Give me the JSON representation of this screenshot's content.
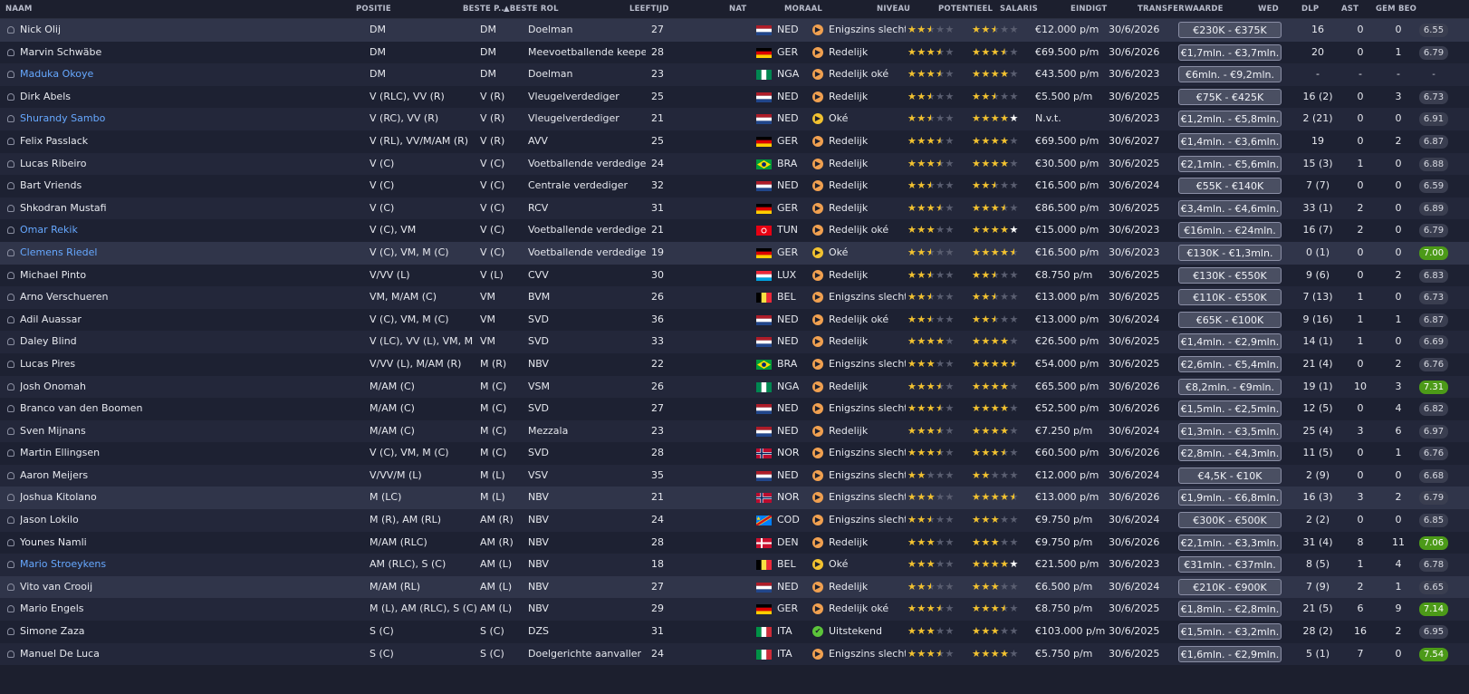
{
  "headers": {
    "naam": "NAAM",
    "positie": "POSITIE",
    "beste_positie": "BESTE P...",
    "beste_rol": "▲BESTE ROL",
    "leeftijd": "LEEFTIJD",
    "nat": "NAT",
    "moraal": "MORAAL",
    "niveau": "NIVEAU",
    "potentieel": "POTENTIEEL",
    "salaris": "SALARIS",
    "eindigt": "EINDIGT",
    "transferwaarde": "TRANSFERWAARDE",
    "wed": "WED",
    "dlp": "DLP",
    "ast": "AST",
    "gem_beo": "GEM BEO"
  },
  "colors": {
    "link": "#66a8ff",
    "moral_orange": "#f0a050",
    "moral_yellow": "#f2c230",
    "moral_green": "#5cc43a",
    "star": "#f2c230",
    "rating_good": "#4c9a18"
  },
  "players": [
    {
      "name": "Nick Olij",
      "link": false,
      "sel": true,
      "positie": "DM",
      "beste_positie": "DM",
      "beste_rol": "Doelman",
      "leeftijd": "27",
      "nat": "NED",
      "flag": "nl",
      "moraal": "Enigszins slecht",
      "moraal_level": "orange",
      "niveau": 2.5,
      "potentieel": 2.5,
      "potentieel_full": false,
      "salaris": "€12.000 p/m",
      "eindigt": "30/6/2026",
      "transferwaarde": "€230K - €375K",
      "wed": "16",
      "dlp": "0",
      "ast": "0",
      "gem_beo": "6.55",
      "gem_good": false
    },
    {
      "name": "Marvin Schwäbe",
      "link": false,
      "sel": false,
      "positie": "DM",
      "beste_positie": "DM",
      "beste_rol": "Meevoetballende keeper",
      "leeftijd": "28",
      "nat": "GER",
      "flag": "de",
      "moraal": "Redelijk",
      "moraal_level": "orange",
      "niveau": 3.5,
      "potentieel": 3.5,
      "potentieel_full": false,
      "salaris": "€69.500 p/m",
      "eindigt": "30/6/2026",
      "transferwaarde": "€1,7mln. - €3,7mln.",
      "wed": "20",
      "dlp": "0",
      "ast": "1",
      "gem_beo": "6.79",
      "gem_good": false
    },
    {
      "name": "Maduka Okoye",
      "link": true,
      "sel": false,
      "positie": "DM",
      "beste_positie": "DM",
      "beste_rol": "Doelman",
      "leeftijd": "23",
      "nat": "NGA",
      "flag": "ng",
      "moraal": "Redelijk oké",
      "moraal_level": "orange",
      "niveau": 3.5,
      "potentieel": 4,
      "potentieel_full": false,
      "salaris": "€43.500 p/m",
      "eindigt": "30/6/2023",
      "transferwaarde": "€6mln. - €9,2mln.",
      "wed": "-",
      "dlp": "-",
      "ast": "-",
      "gem_beo": "-",
      "gem_good": false
    },
    {
      "name": "Dirk Abels",
      "link": false,
      "sel": false,
      "positie": "V (RLC), VV (R)",
      "beste_positie": "V (R)",
      "beste_rol": "Vleugelverdediger",
      "leeftijd": "25",
      "nat": "NED",
      "flag": "nl",
      "moraal": "Redelijk",
      "moraal_level": "orange",
      "niveau": 2.5,
      "potentieel": 2.5,
      "potentieel_full": false,
      "salaris": "€5.500 p/m",
      "eindigt": "30/6/2025",
      "transferwaarde": "€75K - €425K",
      "wed": "16 (2)",
      "dlp": "0",
      "ast": "3",
      "gem_beo": "6.73",
      "gem_good": false
    },
    {
      "name": "Shurandy Sambo",
      "link": true,
      "sel": false,
      "positie": "V (RC), VV (R)",
      "beste_positie": "V (R)",
      "beste_rol": "Vleugelverdediger",
      "leeftijd": "21",
      "nat": "NED",
      "flag": "nl",
      "moraal": "Oké",
      "moraal_level": "yellow",
      "niveau": 2.5,
      "potentieel": 4,
      "potentieel_full": true,
      "salaris": "N.v.t.",
      "eindigt": "30/6/2023",
      "transferwaarde": "€1,2mln. - €5,8mln.",
      "wed": "2 (21)",
      "dlp": "0",
      "ast": "0",
      "gem_beo": "6.91",
      "gem_good": false
    },
    {
      "name": "Felix Passlack",
      "link": false,
      "sel": false,
      "positie": "V (RL), VV/M/AM (R)",
      "beste_positie": "V (R)",
      "beste_rol": "AVV",
      "leeftijd": "25",
      "nat": "GER",
      "flag": "de",
      "moraal": "Redelijk",
      "moraal_level": "orange",
      "niveau": 3.5,
      "potentieel": 4,
      "potentieel_full": false,
      "salaris": "€69.500 p/m",
      "eindigt": "30/6/2027",
      "transferwaarde": "€1,4mln. - €3,6mln.",
      "wed": "19",
      "dlp": "0",
      "ast": "2",
      "gem_beo": "6.87",
      "gem_good": false
    },
    {
      "name": "Lucas Ribeiro",
      "link": false,
      "sel": false,
      "positie": "V (C)",
      "beste_positie": "V (C)",
      "beste_rol": "Voetballende verdediger",
      "leeftijd": "24",
      "nat": "BRA",
      "flag": "br",
      "moraal": "Redelijk",
      "moraal_level": "orange",
      "niveau": 3.5,
      "potentieel": 4,
      "potentieel_full": false,
      "salaris": "€30.500 p/m",
      "eindigt": "30/6/2025",
      "transferwaarde": "€2,1mln. - €5,6mln.",
      "wed": "15 (3)",
      "dlp": "1",
      "ast": "0",
      "gem_beo": "6.88",
      "gem_good": false
    },
    {
      "name": "Bart Vriends",
      "link": false,
      "sel": false,
      "positie": "V (C)",
      "beste_positie": "V (C)",
      "beste_rol": "Centrale verdediger",
      "leeftijd": "32",
      "nat": "NED",
      "flag": "nl",
      "moraal": "Redelijk",
      "moraal_level": "orange",
      "niveau": 2.5,
      "potentieel": 2.5,
      "potentieel_full": false,
      "salaris": "€16.500 p/m",
      "eindigt": "30/6/2024",
      "transferwaarde": "€55K - €140K",
      "wed": "7 (7)",
      "dlp": "0",
      "ast": "0",
      "gem_beo": "6.59",
      "gem_good": false
    },
    {
      "name": "Shkodran Mustafi",
      "link": false,
      "sel": false,
      "positie": "V (C)",
      "beste_positie": "V (C)",
      "beste_rol": "RCV",
      "leeftijd": "31",
      "nat": "GER",
      "flag": "de",
      "moraal": "Redelijk",
      "moraal_level": "orange",
      "niveau": 3.5,
      "potentieel": 3.5,
      "potentieel_full": false,
      "salaris": "€86.500 p/m",
      "eindigt": "30/6/2025",
      "transferwaarde": "€3,4mln. - €4,6mln.",
      "wed": "33 (1)",
      "dlp": "2",
      "ast": "0",
      "gem_beo": "6.89",
      "gem_good": false
    },
    {
      "name": "Omar Rekik",
      "link": true,
      "sel": false,
      "positie": "V (C), VM",
      "beste_positie": "V (C)",
      "beste_rol": "Voetballende verdediger",
      "leeftijd": "21",
      "nat": "TUN",
      "flag": "tn",
      "moraal": "Redelijk oké",
      "moraal_level": "orange",
      "niveau": 3,
      "potentieel": 4,
      "potentieel_full": true,
      "salaris": "€15.000 p/m",
      "eindigt": "30/6/2023",
      "transferwaarde": "€16mln. - €24mln.",
      "wed": "16 (7)",
      "dlp": "2",
      "ast": "0",
      "gem_beo": "6.79",
      "gem_good": false
    },
    {
      "name": "Clemens Riedel",
      "link": true,
      "sel": true,
      "positie": "V (C), VM, M (C)",
      "beste_positie": "V (C)",
      "beste_rol": "Voetballende verdediger",
      "leeftijd": "19",
      "nat": "GER",
      "flag": "de",
      "moraal": "Oké",
      "moraal_level": "yellow",
      "niveau": 2.5,
      "potentieel": 4.5,
      "potentieel_full": false,
      "salaris": "€16.500 p/m",
      "eindigt": "30/6/2023",
      "transferwaarde": "€130K - €1,3mln.",
      "wed": "0 (1)",
      "dlp": "0",
      "ast": "0",
      "gem_beo": "7.00",
      "gem_good": true
    },
    {
      "name": "Michael Pinto",
      "link": false,
      "sel": false,
      "positie": "V/VV (L)",
      "beste_positie": "V (L)",
      "beste_rol": "CVV",
      "leeftijd": "30",
      "nat": "LUX",
      "flag": "lu",
      "moraal": "Redelijk",
      "moraal_level": "orange",
      "niveau": 2.5,
      "potentieel": 2.5,
      "potentieel_full": false,
      "salaris": "€8.750 p/m",
      "eindigt": "30/6/2025",
      "transferwaarde": "€130K - €550K",
      "wed": "9 (6)",
      "dlp": "0",
      "ast": "2",
      "gem_beo": "6.83",
      "gem_good": false
    },
    {
      "name": "Arno Verschueren",
      "link": false,
      "sel": false,
      "positie": "VM, M/AM (C)",
      "beste_positie": "VM",
      "beste_rol": "BVM",
      "leeftijd": "26",
      "nat": "BEL",
      "flag": "be",
      "moraal": "Enigszins slecht",
      "moraal_level": "orange",
      "niveau": 2.5,
      "potentieel": 2.5,
      "potentieel_full": false,
      "salaris": "€13.000 p/m",
      "eindigt": "30/6/2025",
      "transferwaarde": "€110K - €550K",
      "wed": "7 (13)",
      "dlp": "1",
      "ast": "0",
      "gem_beo": "6.73",
      "gem_good": false
    },
    {
      "name": "Adil Auassar",
      "link": false,
      "sel": false,
      "positie": "V (C), VM, M (C)",
      "beste_positie": "VM",
      "beste_rol": "SVD",
      "leeftijd": "36",
      "nat": "NED",
      "flag": "nl",
      "moraal": "Redelijk oké",
      "moraal_level": "orange",
      "niveau": 2.5,
      "potentieel": 2.5,
      "potentieel_full": false,
      "salaris": "€13.000 p/m",
      "eindigt": "30/6/2024",
      "transferwaarde": "€65K - €100K",
      "wed": "9 (16)",
      "dlp": "1",
      "ast": "1",
      "gem_beo": "6.87",
      "gem_good": false
    },
    {
      "name": "Daley Blind",
      "link": false,
      "sel": false,
      "positie": "V (LC), VV (L), VM, M (...",
      "beste_positie": "VM",
      "beste_rol": "SVD",
      "leeftijd": "33",
      "nat": "NED",
      "flag": "nl",
      "moraal": "Redelijk",
      "moraal_level": "orange",
      "niveau": 4,
      "potentieel": 4,
      "potentieel_full": false,
      "salaris": "€26.500 p/m",
      "eindigt": "30/6/2025",
      "transferwaarde": "€1,4mln. - €2,9mln.",
      "wed": "14 (1)",
      "dlp": "1",
      "ast": "0",
      "gem_beo": "6.69",
      "gem_good": false
    },
    {
      "name": "Lucas Pires",
      "link": false,
      "sel": false,
      "positie": "V/VV (L), M/AM (R)",
      "beste_positie": "M (R)",
      "beste_rol": "NBV",
      "leeftijd": "22",
      "nat": "BRA",
      "flag": "br",
      "moraal": "Enigszins slecht",
      "moraal_level": "orange",
      "niveau": 3,
      "potentieel": 4.5,
      "potentieel_full": false,
      "salaris": "€54.000 p/m",
      "eindigt": "30/6/2025",
      "transferwaarde": "€2,6mln. - €5,4mln.",
      "wed": "21 (4)",
      "dlp": "0",
      "ast": "2",
      "gem_beo": "6.76",
      "gem_good": false
    },
    {
      "name": "Josh Onomah",
      "link": false,
      "sel": false,
      "positie": "M/AM (C)",
      "beste_positie": "M (C)",
      "beste_rol": "VSM",
      "leeftijd": "26",
      "nat": "NGA",
      "flag": "ng",
      "moraal": "Redelijk",
      "moraal_level": "orange",
      "niveau": 3.5,
      "potentieel": 4,
      "potentieel_full": false,
      "salaris": "€65.500 p/m",
      "eindigt": "30/6/2026",
      "transferwaarde": "€8,2mln. - €9mln.",
      "wed": "19 (1)",
      "dlp": "10",
      "ast": "3",
      "gem_beo": "7.31",
      "gem_good": true
    },
    {
      "name": "Branco van den Boomen",
      "link": false,
      "sel": false,
      "positie": "M/AM (C)",
      "beste_positie": "M (C)",
      "beste_rol": "SVD",
      "leeftijd": "27",
      "nat": "NED",
      "flag": "nl",
      "moraal": "Enigszins slecht",
      "moraal_level": "orange",
      "niveau": 3.5,
      "potentieel": 4,
      "potentieel_full": false,
      "salaris": "€52.500 p/m",
      "eindigt": "30/6/2026",
      "transferwaarde": "€1,5mln. - €2,5mln.",
      "wed": "12 (5)",
      "dlp": "0",
      "ast": "4",
      "gem_beo": "6.82",
      "gem_good": false
    },
    {
      "name": "Sven Mijnans",
      "link": false,
      "sel": false,
      "positie": "M/AM (C)",
      "beste_positie": "M (C)",
      "beste_rol": "Mezzala",
      "leeftijd": "23",
      "nat": "NED",
      "flag": "nl",
      "moraal": "Redelijk",
      "moraal_level": "orange",
      "niveau": 3.5,
      "potentieel": 4,
      "potentieel_full": false,
      "salaris": "€7.250 p/m",
      "eindigt": "30/6/2024",
      "transferwaarde": "€1,3mln. - €3,5mln.",
      "wed": "25 (4)",
      "dlp": "3",
      "ast": "6",
      "gem_beo": "6.97",
      "gem_good": false
    },
    {
      "name": "Martin Ellingsen",
      "link": false,
      "sel": false,
      "positie": "V (C), VM, M (C)",
      "beste_positie": "M (C)",
      "beste_rol": "SVD",
      "leeftijd": "28",
      "nat": "NOR",
      "flag": "no",
      "moraal": "Enigszins slecht",
      "moraal_level": "orange",
      "niveau": 3.5,
      "potentieel": 3.5,
      "potentieel_full": false,
      "salaris": "€60.500 p/m",
      "eindigt": "30/6/2026",
      "transferwaarde": "€2,8mln. - €4,3mln.",
      "wed": "11 (5)",
      "dlp": "0",
      "ast": "1",
      "gem_beo": "6.76",
      "gem_good": false
    },
    {
      "name": "Aaron Meijers",
      "link": false,
      "sel": false,
      "positie": "V/VV/M (L)",
      "beste_positie": "M (L)",
      "beste_rol": "VSV",
      "leeftijd": "35",
      "nat": "NED",
      "flag": "nl",
      "moraal": "Enigszins slecht",
      "moraal_level": "orange",
      "niveau": 2,
      "potentieel": 2,
      "potentieel_full": false,
      "salaris": "€12.000 p/m",
      "eindigt": "30/6/2024",
      "transferwaarde": "€4,5K - €10K",
      "wed": "2 (9)",
      "dlp": "0",
      "ast": "0",
      "gem_beo": "6.68",
      "gem_good": false
    },
    {
      "name": "Joshua Kitolano",
      "link": false,
      "sel": true,
      "positie": "M (LC)",
      "beste_positie": "M (L)",
      "beste_rol": "NBV",
      "leeftijd": "21",
      "nat": "NOR",
      "flag": "no",
      "moraal": "Enigszins slecht",
      "moraal_level": "orange",
      "niveau": 3,
      "potentieel": 4.5,
      "potentieel_full": false,
      "salaris": "€13.000 p/m",
      "eindigt": "30/6/2026",
      "transferwaarde": "€1,9mln. - €6,8mln.",
      "wed": "16 (3)",
      "dlp": "3",
      "ast": "2",
      "gem_beo": "6.79",
      "gem_good": false
    },
    {
      "name": "Jason Lokilo",
      "link": false,
      "sel": false,
      "positie": "M (R), AM (RL)",
      "beste_positie": "AM (R)",
      "beste_rol": "NBV",
      "leeftijd": "24",
      "nat": "COD",
      "flag": "cd",
      "moraal": "Enigszins slecht",
      "moraal_level": "orange",
      "niveau": 2.5,
      "potentieel": 3,
      "potentieel_full": false,
      "salaris": "€9.750 p/m",
      "eindigt": "30/6/2024",
      "transferwaarde": "€300K - €500K",
      "wed": "2 (2)",
      "dlp": "0",
      "ast": "0",
      "gem_beo": "6.85",
      "gem_good": false
    },
    {
      "name": "Younes Namli",
      "link": false,
      "sel": false,
      "positie": "M/AM (RLC)",
      "beste_positie": "AM (R)",
      "beste_rol": "NBV",
      "leeftijd": "28",
      "nat": "DEN",
      "flag": "dk",
      "moraal": "Redelijk",
      "moraal_level": "orange",
      "niveau": 3,
      "potentieel": 3,
      "potentieel_full": false,
      "salaris": "€9.750 p/m",
      "eindigt": "30/6/2026",
      "transferwaarde": "€2,1mln. - €3,3mln.",
      "wed": "31 (4)",
      "dlp": "8",
      "ast": "11",
      "gem_beo": "7.06",
      "gem_good": true
    },
    {
      "name": "Mario Stroeykens",
      "link": true,
      "sel": false,
      "positie": "AM (RLC), S (C)",
      "beste_positie": "AM (L)",
      "beste_rol": "NBV",
      "leeftijd": "18",
      "nat": "BEL",
      "flag": "be",
      "moraal": "Oké",
      "moraal_level": "yellow",
      "niveau": 3,
      "potentieel": 4,
      "potentieel_full": true,
      "salaris": "€21.500 p/m",
      "eindigt": "30/6/2023",
      "transferwaarde": "€31mln. - €37mln.",
      "wed": "8 (5)",
      "dlp": "1",
      "ast": "4",
      "gem_beo": "6.78",
      "gem_good": false
    },
    {
      "name": "Vito van Crooij",
      "link": false,
      "sel": true,
      "positie": "M/AM (RL)",
      "beste_positie": "AM (L)",
      "beste_rol": "NBV",
      "leeftijd": "27",
      "nat": "NED",
      "flag": "nl",
      "moraal": "Redelijk",
      "moraal_level": "orange",
      "niveau": 2.5,
      "potentieel": 3,
      "potentieel_full": false,
      "salaris": "€6.500 p/m",
      "eindigt": "30/6/2024",
      "transferwaarde": "€210K - €900K",
      "wed": "7 (9)",
      "dlp": "2",
      "ast": "1",
      "gem_beo": "6.65",
      "gem_good": false
    },
    {
      "name": "Mario Engels",
      "link": false,
      "sel": false,
      "positie": "M (L), AM (RLC), S (C)",
      "beste_positie": "AM (L)",
      "beste_rol": "NBV",
      "leeftijd": "29",
      "nat": "GER",
      "flag": "de",
      "moraal": "Redelijk oké",
      "moraal_level": "orange",
      "niveau": 3.5,
      "potentieel": 3.5,
      "potentieel_full": false,
      "salaris": "€8.750 p/m",
      "eindigt": "30/6/2025",
      "transferwaarde": "€1,8mln. - €2,8mln.",
      "wed": "21 (5)",
      "dlp": "6",
      "ast": "9",
      "gem_beo": "7.14",
      "gem_good": true
    },
    {
      "name": "Simone Zaza",
      "link": false,
      "sel": false,
      "positie": "S (C)",
      "beste_positie": "S (C)",
      "beste_rol": "DZS",
      "leeftijd": "31",
      "nat": "ITA",
      "flag": "it",
      "moraal": "Uitstekend",
      "moraal_level": "green",
      "niveau": 3,
      "potentieel": 3,
      "potentieel_full": false,
      "salaris": "€103.000 p/m",
      "eindigt": "30/6/2025",
      "transferwaarde": "€1,5mln. - €3,2mln.",
      "wed": "28 (2)",
      "dlp": "16",
      "ast": "2",
      "gem_beo": "6.95",
      "gem_good": false
    },
    {
      "name": "Manuel De Luca",
      "link": false,
      "sel": false,
      "positie": "S (C)",
      "beste_positie": "S (C)",
      "beste_rol": "Doelgerichte aanvaller",
      "leeftijd": "24",
      "nat": "ITA",
      "flag": "it",
      "moraal": "Enigszins slecht",
      "moraal_level": "orange",
      "niveau": 3.5,
      "potentieel": 4,
      "potentieel_full": false,
      "salaris": "€5.750 p/m",
      "eindigt": "30/6/2025",
      "transferwaarde": "€1,6mln. - €2,9mln.",
      "wed": "5 (1)",
      "dlp": "7",
      "ast": "0",
      "gem_beo": "7.54",
      "gem_good": true
    }
  ]
}
